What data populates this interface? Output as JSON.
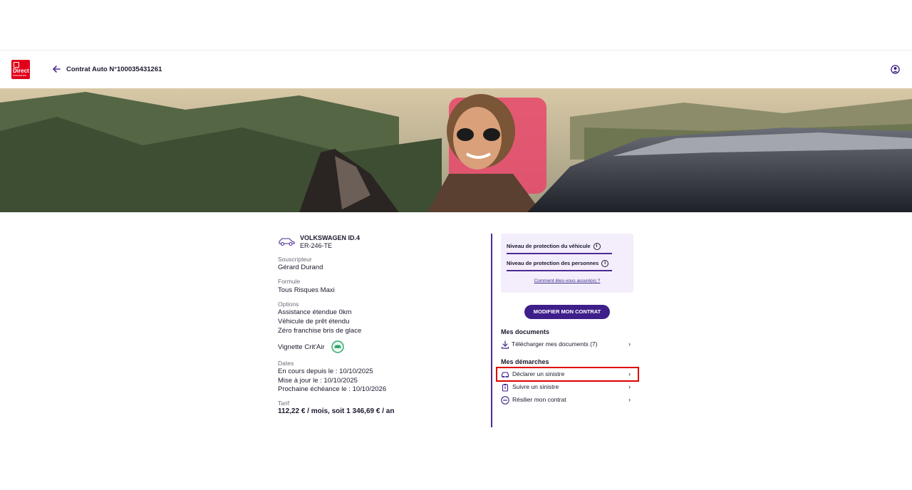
{
  "header": {
    "logo_text": "Direct",
    "logo_subtext": "Assurance",
    "title": "Contrat Auto N°100035431261"
  },
  "vehicle": {
    "model": "VOLKSWAGEN ID.4",
    "plate": "ER-246-TE"
  },
  "details": {
    "souscripteur_label": "Souscripteur",
    "souscripteur_value": "Gérard Durand",
    "formule_label": "Formule",
    "formule_value": "Tous Risques Maxi",
    "options_label": "Options",
    "options": [
      "Assistance étendue 0km",
      "Véhicule de prêt étendu",
      "Zéro franchise bris de glace"
    ],
    "vignette": "Vignette Crit'Air",
    "dates_label": "Dates",
    "dates": [
      "En cours depuis le : 10/10/2025",
      "Mise à jour le : 10/10/2025",
      "Prochaine échéance le : 10/10/2026"
    ],
    "tarif_label": "Tarif",
    "tarif_value": "112,22 € / mois, soit 1 346,69 € / an"
  },
  "protection": {
    "vehicule": "Niveau de protection du véhicule",
    "personnes": "Niveau de protection des personnes",
    "link": "Comment êtes-vous assuré(e) ?"
  },
  "actions": {
    "modify": "MODIFIER MON CONTRAT",
    "documents_title": "Mes documents",
    "download_docs": "Télécharger mes documents (7)",
    "demarches_title": "Mes démarches",
    "declare": "Déclarer un sinistre",
    "follow": "Suivre un sinistre",
    "cancel": "Résilier mon contrat"
  },
  "colors": {
    "brand_red": "#e2001a",
    "primary_purple": "#3e1f8a",
    "protect_bg": "#f4edfb",
    "critair_green": "#2ea66b",
    "highlight_red": "#e00000"
  },
  "icons": [
    "back-arrow-icon",
    "user-profile-icon",
    "car-icon",
    "critair-icon",
    "info-icon",
    "download-icon",
    "car-crash-icon",
    "clipboard-icon",
    "minus-circle-icon",
    "chevron-right-icon"
  ]
}
